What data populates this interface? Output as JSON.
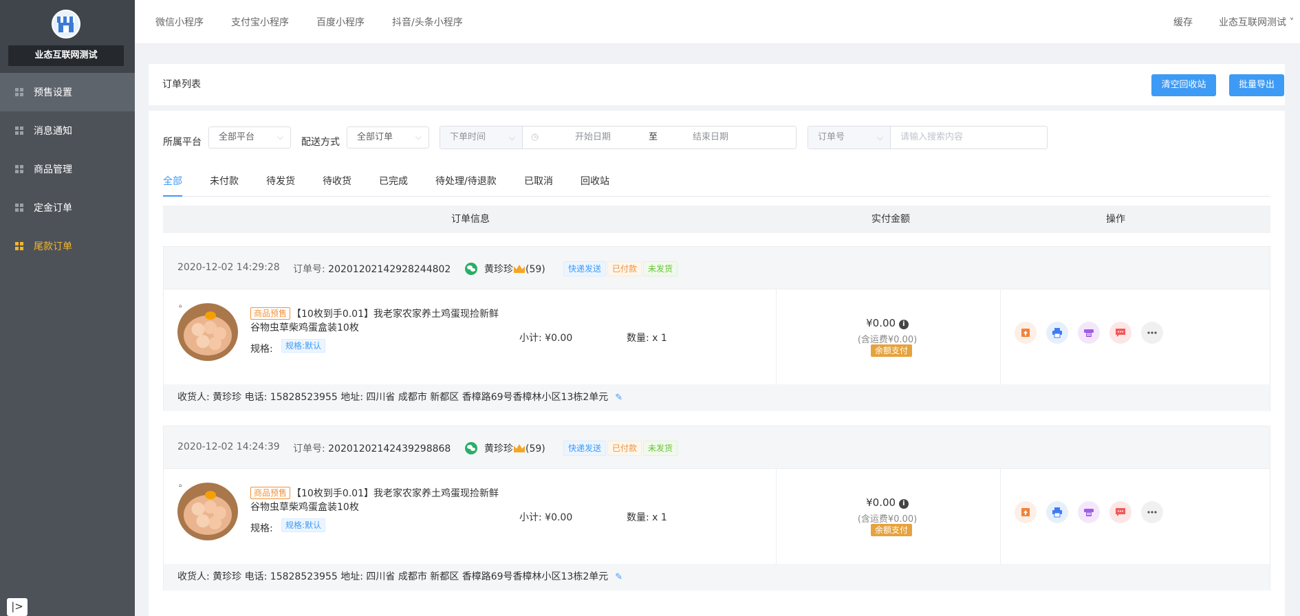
{
  "sidebar": {
    "store_name": "业态互联网测试",
    "items": [
      {
        "label": "预售设置"
      },
      {
        "label": "消息通知"
      },
      {
        "label": "商品管理"
      },
      {
        "label": "定金订单"
      },
      {
        "label": "尾款订单"
      }
    ],
    "collapse_label": "|>"
  },
  "topbar": {
    "nav": [
      "微信小程序",
      "支付宝小程序",
      "百度小程序",
      "抖音/头条小程序"
    ],
    "cache": "缓存",
    "user": "业态互联网测试 ˅"
  },
  "header": {
    "title": "订单列表",
    "clear_recycle": "清空回收站",
    "batch_export": "批量导出"
  },
  "filters": {
    "platform_label": "所属平台",
    "platform_value": "全部平台",
    "delivery_label": "配送方式",
    "delivery_value": "全部订单",
    "time_type": "下单时间",
    "start_placeholder": "开始日期",
    "to": "至",
    "end_placeholder": "结束日期",
    "search_type": "订单号",
    "search_placeholder": "请输入搜索内容"
  },
  "tabs": [
    "全部",
    "未付款",
    "待发货",
    "待收货",
    "已完成",
    "待处理/待退款",
    "已取消",
    "回收站"
  ],
  "table_header": {
    "info": "订单信息",
    "amount": "实付金额",
    "ops": "操作"
  },
  "orders": [
    {
      "date": "2020-12-02 14:29:28",
      "order_no_label": "订单号:",
      "order_no": "20201202142928244802",
      "buyer": "黄珍珍",
      "buyer_level": "(59)",
      "tags": [
        "快递发送",
        "已付款",
        "未发货"
      ],
      "presale_tag": "商品预售",
      "product_name": "【10枚到手0.01】我老家农家养土鸡蛋现捡新鲜谷物虫草柴鸡蛋盒装10枚",
      "spec_label": "规格:",
      "spec_value": "规格:默认",
      "subtotal": "小计: ¥0.00",
      "quantity": "数量: x 1",
      "amount": "¥0.00",
      "fee": "(含运费¥0.00)",
      "pay_method": "余额支付",
      "receiver": "收货人: 黄珍珍 电话: 15828523955 地址: 四川省 成都市 新都区 香樟路69号香樟林小区13栋2单元"
    },
    {
      "date": "2020-12-02 14:24:39",
      "order_no_label": "订单号:",
      "order_no": "20201202142439298868",
      "buyer": "黄珍珍",
      "buyer_level": "(59)",
      "tags": [
        "快递发送",
        "已付款",
        "未发货"
      ],
      "presale_tag": "商品预售",
      "product_name": "【10枚到手0.01】我老家农家养土鸡蛋现捡新鲜谷物虫草柴鸡蛋盒装10枚",
      "spec_label": "规格:",
      "spec_value": "规格:默认",
      "subtotal": "小计: ¥0.00",
      "quantity": "数量: x 1",
      "amount": "¥0.00",
      "fee": "(含运费¥0.00)",
      "pay_method": "余额支付",
      "receiver": "收货人: 黄珍珍 电话: 15828523955 地址: 四川省 成都市 新都区 香樟路69号香樟林小区13栋2单元"
    }
  ],
  "colors": {
    "accent": "#3d9af5",
    "sidebar_bg": "#4d5258",
    "active_menu": "#f7b52c",
    "pay_tag": "#e6a23c"
  }
}
